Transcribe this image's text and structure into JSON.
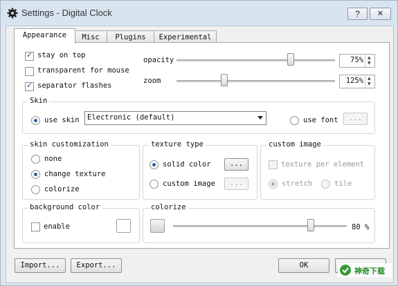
{
  "window": {
    "title": "Settings - Digital Clock",
    "help_label": "?",
    "close_label": "✕"
  },
  "tabs": [
    "Appearance",
    "Misc",
    "Plugins",
    "Experimental"
  ],
  "general": {
    "stay_on_top": {
      "label": "stay on top",
      "checked": true
    },
    "transparent_for_mouse": {
      "label": "transparent for mouse",
      "checked": false
    },
    "separator_flashes": {
      "label": "separator flashes",
      "checked": true
    },
    "opacity": {
      "label": "opacity",
      "value": "75%",
      "level": 0.75
    },
    "zoom": {
      "label": "zoom",
      "value": "125%",
      "level": 0.3
    }
  },
  "skin": {
    "title": "Skin",
    "use_skin_label": "use skin",
    "skin_value": "Electronic (default)",
    "use_font_label": "use font",
    "font_button": "..."
  },
  "skin_customization": {
    "title": "skin customization",
    "options": [
      "none",
      "change texture",
      "colorize"
    ],
    "selected": 1
  },
  "texture_type": {
    "title": "texture type",
    "solid_color": "solid color",
    "custom_image": "custom image",
    "button": "..."
  },
  "custom_image": {
    "title": "custom image",
    "texture_per_element": "texture per element",
    "stretch": "stretch",
    "tile": "tile"
  },
  "background_color": {
    "title": "background color",
    "enable": "enable"
  },
  "colorize": {
    "title": "colorize",
    "value": "80 %",
    "level": 0.8
  },
  "footer": {
    "import": "Import...",
    "export": "Export...",
    "ok": "OK",
    "watermark": "神奇下载"
  },
  "colors": {
    "accent": "#2a5fa0",
    "window_frame": "#d9e4f1"
  }
}
